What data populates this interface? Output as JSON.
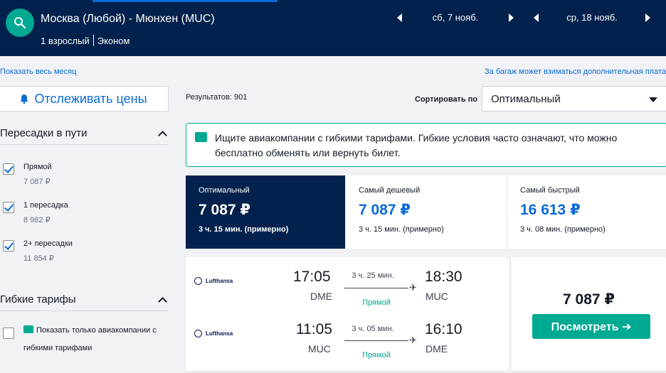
{
  "header": {
    "route": "Москва (Любой) - Мюнхен (MUC)",
    "passengers": "1 взрослый",
    "cabin": "Эконом",
    "depart_date": "сб, 7 нояб.",
    "return_date": "ср, 18 нояб."
  },
  "links": {
    "show_month": "Показать весь месяц",
    "baggage_note": "За багаж может взиматься дополнительная плата"
  },
  "sidebar": {
    "track_prices": "Отслеживать цены",
    "stops_title": "Пересадки в пути",
    "stops": [
      {
        "label": "Прямой",
        "price": "7 087 ₽",
        "checked": true
      },
      {
        "label": "1 пересадка",
        "price": "8 982 ₽",
        "checked": true
      },
      {
        "label": "2+ пересадки",
        "price": "11 854 ₽",
        "checked": true
      }
    ],
    "flex_title": "Гибкие тарифы",
    "flex_option": "Показать только авиакомпании с гибкими тарифами",
    "flex_checked": false
  },
  "results": {
    "count_text": "Результатов: 901",
    "sort_label": "Сортировать по",
    "sort_value": "Оптимальный"
  },
  "info": {
    "text": "Ищите авиакомпании с гибкими тарифами. Гибкие условия часто означают, что можно бесплатно обменять или вернуть билет."
  },
  "sort_tabs": [
    {
      "title": "Оптимальный",
      "price": "7 087 ₽",
      "duration": "3 ч. 15 мин. (примерно)",
      "active": true
    },
    {
      "title": "Самый дешевый",
      "price": "7 087 ₽",
      "duration": "3 ч. 15 мин. (примерно)",
      "active": false
    },
    {
      "title": "Самый быстрый",
      "price": "16 613 ₽",
      "duration": "3 ч. 08 мин. (примерно)",
      "active": false
    }
  ],
  "offer": {
    "legs": [
      {
        "airline": "Lufthansa",
        "dep_time": "17:05",
        "dep_airport": "DME",
        "arr_time": "18:30",
        "arr_airport": "MUC",
        "duration": "3 ч. 25 мин.",
        "stops": "Прямой"
      },
      {
        "airline": "Lufthansa",
        "dep_time": "11:05",
        "dep_airport": "MUC",
        "arr_time": "16:10",
        "arr_airport": "DME",
        "duration": "3 ч. 05 мин.",
        "stops": "Прямой"
      }
    ],
    "price": "7 087 ₽",
    "button": "Посмотреть ➔"
  },
  "colors": {
    "header_bg": "#02214c",
    "accent_green": "#00a991",
    "link_blue": "#0b6bd7"
  }
}
